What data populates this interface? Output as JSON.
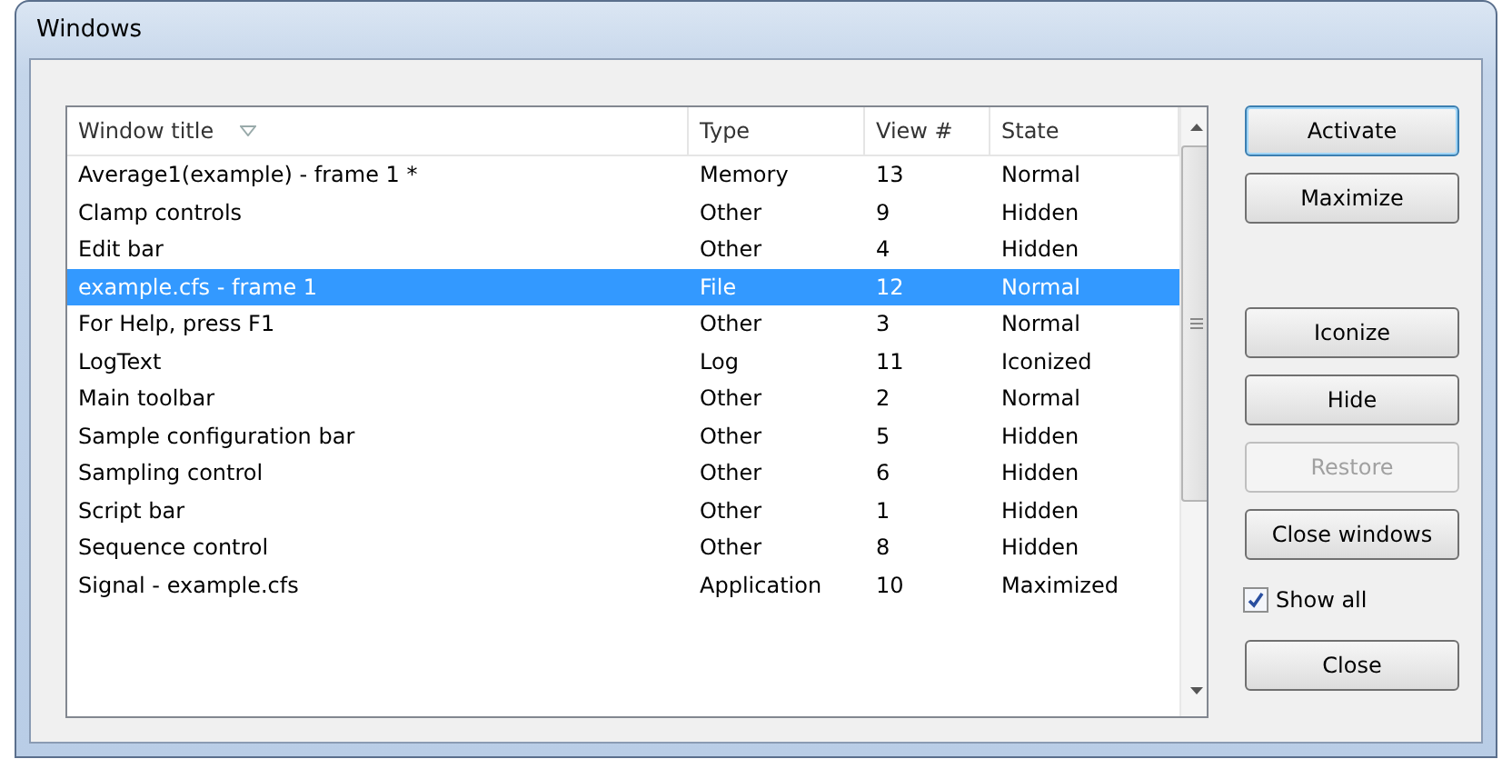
{
  "window": {
    "title": "Windows"
  },
  "table": {
    "columns": [
      {
        "label": "Window title",
        "sorted": true
      },
      {
        "label": "Type",
        "sorted": false
      },
      {
        "label": "View #",
        "sorted": false
      },
      {
        "label": "State",
        "sorted": false
      }
    ],
    "rows": [
      {
        "cells": [
          "Average1(example) - frame 1 *",
          "Memory",
          "13",
          "Normal"
        ],
        "selected": false
      },
      {
        "cells": [
          "Clamp controls",
          "Other",
          "9",
          "Hidden"
        ],
        "selected": false
      },
      {
        "cells": [
          "Edit bar",
          "Other",
          "4",
          "Hidden"
        ],
        "selected": false
      },
      {
        "cells": [
          "example.cfs - frame 1",
          "File",
          "12",
          "Normal"
        ],
        "selected": true
      },
      {
        "cells": [
          "For Help, press F1",
          "Other",
          "3",
          "Normal"
        ],
        "selected": false
      },
      {
        "cells": [
          "LogText",
          "Log",
          "11",
          "Iconized"
        ],
        "selected": false
      },
      {
        "cells": [
          "Main toolbar",
          "Other",
          "2",
          "Normal"
        ],
        "selected": false
      },
      {
        "cells": [
          "Sample configuration bar",
          "Other",
          "5",
          "Hidden"
        ],
        "selected": false
      },
      {
        "cells": [
          "Sampling control",
          "Other",
          "6",
          "Hidden"
        ],
        "selected": false
      },
      {
        "cells": [
          "Script bar",
          "Other",
          "1",
          "Hidden"
        ],
        "selected": false
      },
      {
        "cells": [
          "Sequence control",
          "Other",
          "8",
          "Hidden"
        ],
        "selected": false
      },
      {
        "cells": [
          "Signal - example.cfs",
          "Application",
          "10",
          "Maximized"
        ],
        "selected": false
      }
    ]
  },
  "buttons": [
    {
      "kind": "button",
      "label": "Activate",
      "default": true,
      "disabled": false
    },
    {
      "kind": "button",
      "label": "Maximize",
      "default": false,
      "disabled": false
    },
    {
      "kind": "spacer"
    },
    {
      "kind": "button",
      "label": "Iconize",
      "default": false,
      "disabled": false
    },
    {
      "kind": "button",
      "label": "Hide",
      "default": false,
      "disabled": false
    },
    {
      "kind": "button",
      "label": "Restore",
      "default": false,
      "disabled": true
    },
    {
      "kind": "button",
      "label": "Close windows",
      "default": false,
      "disabled": false
    },
    {
      "kind": "checkbox",
      "label": "Show all",
      "checked": true
    },
    {
      "kind": "button",
      "label": "Close",
      "default": false,
      "disabled": false
    }
  ]
}
